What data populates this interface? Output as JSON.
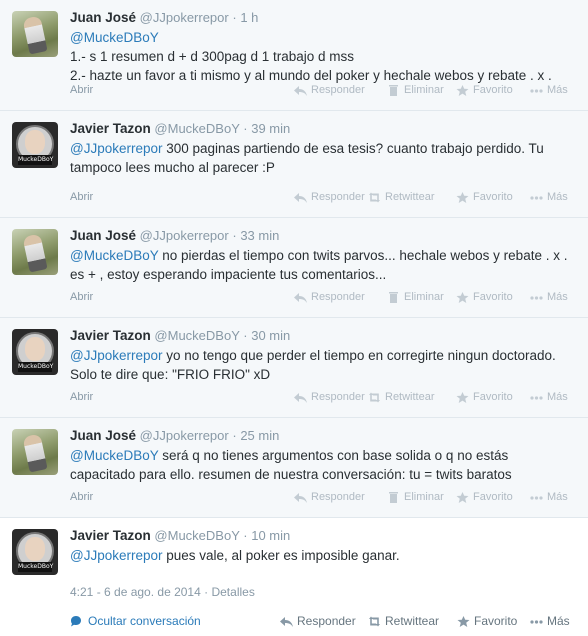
{
  "tweets": [
    {
      "author": "Juan José",
      "handle": "@JJpokerrepor",
      "time": "1 h",
      "mention": "@MuckeDBoY",
      "text": "",
      "lines": [
        "1.- s 1 resumen d + d 300pag d 1 trabajo d mss",
        "2.- hazte un favor a ti mismo y al mundo del poker y hechale webos y rebate . x ."
      ],
      "own": true
    },
    {
      "author": "Javier Tazon",
      "handle": "@MuckeDBoY",
      "time": "39 min",
      "mention": "@JJpokerrepor",
      "text": " 300 paginas partiendo de esa tesis? cuanto trabajo perdido. Tu tampoco lees mucho al parecer :P",
      "own": false
    },
    {
      "author": "Juan José",
      "handle": "@JJpokerrepor",
      "time": "33 min",
      "mention": "@MuckeDBoY",
      "text": " no pierdas el tiempo con twits parvos... hechale webos y rebate . x . es + , estoy esperando impaciente tus comentarios...",
      "own": true
    },
    {
      "author": "Javier Tazon",
      "handle": "@MuckeDBoY",
      "time": "30 min",
      "mention": "@JJpokerrepor",
      "text": " yo no tengo que perder el tiempo en corregirte ningun doctorado. Solo te dire que: \"FRIO FRIO\" xD",
      "own": false
    },
    {
      "author": "Juan José",
      "handle": "@JJpokerrepor",
      "time": "25 min",
      "mention": "@MuckeDBoY",
      "text": " será q no tienes argumentos con base solida o q no estás capacitado para ello. resumen de nuestra conversación: tu = twits baratos",
      "own": true
    },
    {
      "author": "Javier Tazon",
      "handle": "@MuckeDBoY",
      "time": "10 min",
      "mention": "@JJpokerrepor",
      "text": " pues vale, al poker es imposible ganar.",
      "own": false
    }
  ],
  "avatar_badge": "MuckeDBoY",
  "avatar_badge_num": "52",
  "dot": "·",
  "labels": {
    "open": "Abrir",
    "reply": "Responder",
    "delete": "Eliminar",
    "retweet": "Retwittear",
    "favorite": "Favorito",
    "more": "Más",
    "hide_conversation": "Ocultar conversación",
    "details": "Detalles"
  },
  "last_timestamp": "4:21 - 6 de ago. de 2014",
  "colors": {
    "link": "#2b7bb9",
    "meta": "#8899a6",
    "bg_thread": "#f5f8fa"
  }
}
